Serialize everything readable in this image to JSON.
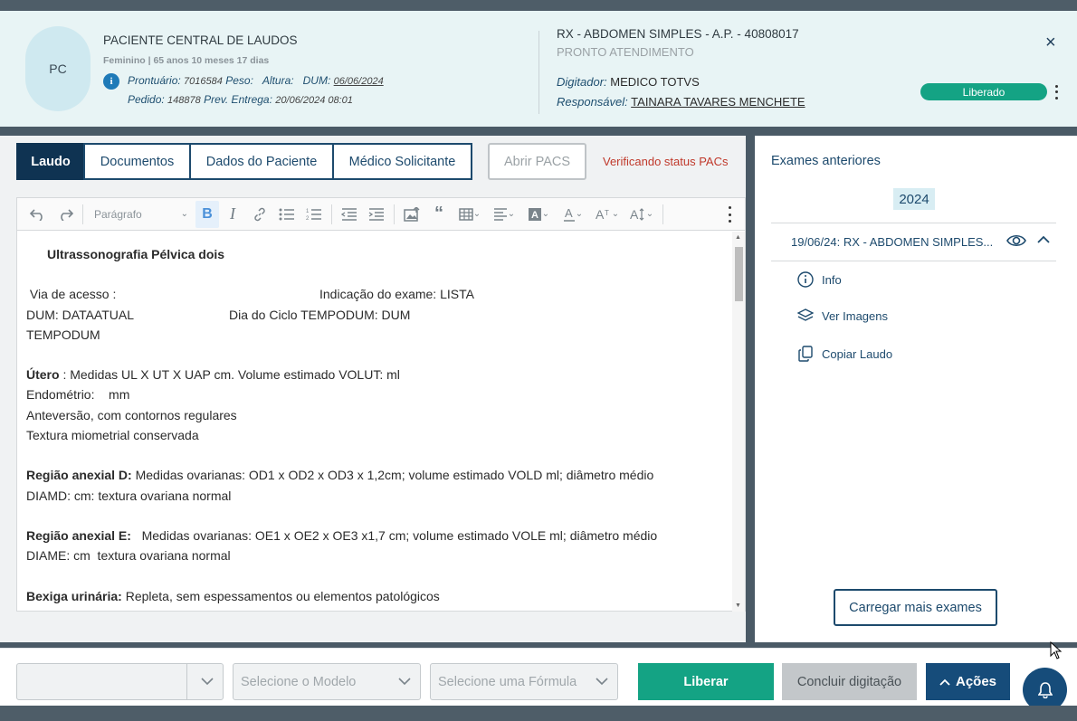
{
  "header": {
    "avatar_initials": "PC",
    "patient_name": "PACIENTE CENTRAL DE LAUDOS",
    "patient_sub": "Feminino | 65 anos 10 meses 17 dias",
    "info_icon_text": "i",
    "prontuario_label": "Prontuário:",
    "prontuario_value": "7016584",
    "peso_label": "Peso:",
    "altura_label": "Altura:",
    "dum_label": "DUM:",
    "dum_value": "06/06/2024",
    "pedido_label": "Pedido:",
    "pedido_value": "148878",
    "prev_entrega_label": "Prev. Entrega:",
    "prev_entrega_value": "20/06/2024 08:01",
    "exam_title": "RX - ABDOMEN SIMPLES - A.P. - 40808017",
    "exam_sub": "PRONTO ATENDIMENTO",
    "digitador_label": "Digitador:",
    "digitador_value": "MEDICO TOTVS",
    "responsavel_label": "Responsável:",
    "responsavel_value": "TAINARA TAVARES MENCHETE",
    "close_icon": "×",
    "status_badge": "Liberado"
  },
  "tabs": [
    "Laudo",
    "Documentos",
    "Dados do Paciente",
    "Médico Solicitante"
  ],
  "pacs_button": "Abrir PACS",
  "pacs_status": "Verificando status PACs",
  "toolbar": {
    "paragraph_select": "Parágrafo"
  },
  "document": {
    "title": "Ultrassonografia Pélvica dois",
    "via_acesso": " Via de acesso :",
    "indicacao": "Indicação do exame: LISTA",
    "dum_line": "DUM: DATAATUAL",
    "dia_ciclo": "Dia do Ciclo TEMPODUM: DUM",
    "tempodum": "TEMPODUM",
    "utero_label": "Útero",
    "utero_text": " : Medidas UL X UT X UAP cm. Volume estimado VOLUT: ml",
    "endometrio": "Endométrio:    mm",
    "anteversao": "Anteversão, com contornos regulares",
    "textura": "Textura miometrial conservada",
    "anexial_d_label": "Região anexial D:",
    "anexial_d_text": " Medidas ovarianas: OD1 x OD2 x OD3 x 1,2cm; volume estimado VOLD ml; diâmetro médio",
    "anexial_d_text2": "DIAMD: cm: textura ovariana normal",
    "anexial_e_label": "Região anexial E:",
    "anexial_e_text": "   Medidas ovarianas: OE1 x OE2 x OE3 x1,7 cm; volume estimado VOLE ml; diâmetro médio",
    "anexial_e_text2": "DIAME: cm  textura ovariana normal",
    "bexiga_label": "Bexiga urinária:",
    "bexiga_text": " Repleta, sem espessamentos ou elementos patológicos"
  },
  "side": {
    "title": "Exames anteriores",
    "year": "2024",
    "exam_row": "19/06/24: RX - ABDOMEN SIMPLES...",
    "actions": [
      "Info",
      "Ver Imagens",
      "Copiar Laudo"
    ],
    "load_more": "Carregar mais exames"
  },
  "footer": {
    "modelo_placeholder": "Selecione o Modelo",
    "formula_placeholder": "Selecione uma Fórmula",
    "liberar": "Liberar",
    "concluir": "Concluir digitação",
    "acoes": "Ações"
  },
  "colors": {
    "primary": "#164c7a",
    "success": "#14a384",
    "danger": "#c0392b",
    "header_bg": "#e8f4f5"
  }
}
